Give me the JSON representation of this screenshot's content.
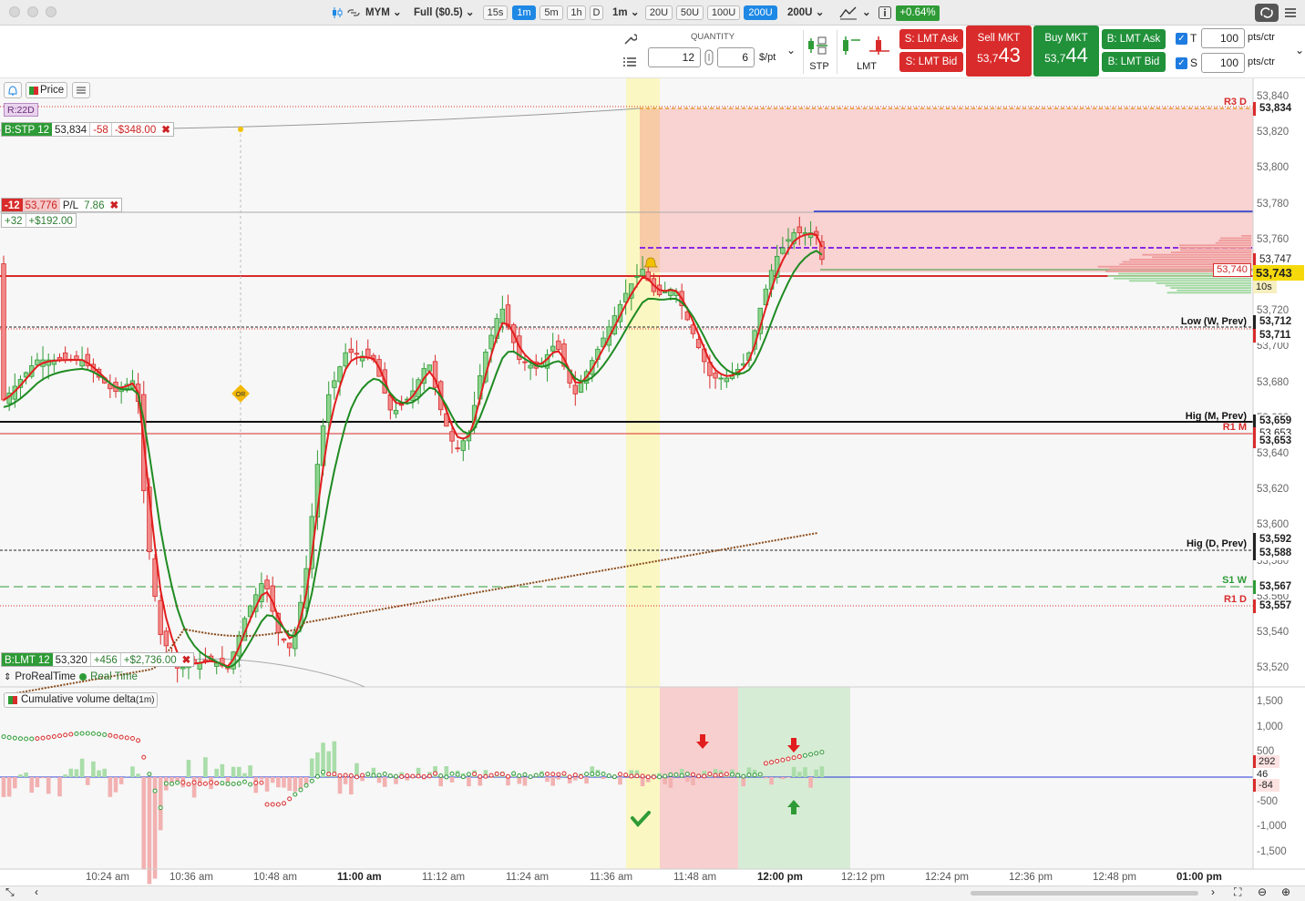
{
  "toolbar": {
    "symbol": "MYM",
    "contract": "Full ($0.5)",
    "intervals": [
      "15s",
      "1m",
      "5m",
      "1h",
      "D"
    ],
    "active_interval": "1m",
    "bar_interval": "1m",
    "ranges": [
      "20U",
      "50U",
      "100U",
      "200U"
    ],
    "active_range": "200U",
    "range_select": "200U",
    "change_pct": "+0.64%"
  },
  "order_panel": {
    "quantity_label": "QUANTITY",
    "quantity": "12",
    "per_point": "6",
    "per_point_unit": "$/pt",
    "stp_label": "STP",
    "lmt_label": "LMT",
    "s_lmt_ask": "S: LMT Ask",
    "s_lmt_bid": "S: LMT Bid",
    "sell_mkt_label": "Sell MKT",
    "sell_price_prefix": "53,7",
    "sell_price_big": "43",
    "buy_mkt_label": "Buy MKT",
    "buy_price_prefix": "53,7",
    "buy_price_big": "44",
    "b_lmt_ask": "B: LMT Ask",
    "b_lmt_bid": "B: LMT Bid",
    "t_label": "T",
    "t_value": "100",
    "s_label": "S",
    "s_value": "100",
    "pts_ctr": "pts/ctr"
  },
  "chart_header": {
    "price_label": "Price",
    "r22d": "R:22D",
    "stp_order": {
      "label": "B:STP 12",
      "price": "53,834",
      "pts": "-58",
      "usd": "-$348.00"
    },
    "position": {
      "qty": "-12",
      "price": "53,776",
      "pl_label": "P/L",
      "pl": "7.86",
      "pts": "+32",
      "usd": "+$192.00"
    },
    "lmt_order": {
      "label": "B:LMT 12",
      "price": "53,320",
      "pts": "+456",
      "usd": "+$2,736.00"
    },
    "feed": "ProRealTime",
    "feed_status": "Real Time",
    "or_badge": "OR",
    "timer": "10s"
  },
  "levels": {
    "r3d": "R3 D",
    "low_w": "Low (W, Prev)",
    "hig_m": "Hig (M, Prev)",
    "r1m": "R1 M",
    "hig_d": "Hig (D, Prev)",
    "s1w": "S1 W",
    "r1d": "R1 D"
  },
  "price_tags": {
    "r3d": "53,834",
    "ask_a": "53,747",
    "last": "53,743",
    "entry": "53,740",
    "low_w": "53,712",
    "low_w2": "53,711",
    "hig_m": "53,659",
    "r1m_a": "53,653",
    "r1m_b": "53,653",
    "hig_d": "53,592",
    "hig_d2": "53,588",
    "s1w": "53,567",
    "r1d": "53,557"
  },
  "y_axis": [
    "53,840",
    "53,820",
    "53,800",
    "53,780",
    "53,760",
    "53,740",
    "53,720",
    "53,700",
    "53,680",
    "53,660",
    "53,640",
    "53,620",
    "53,600",
    "53,580",
    "53,560",
    "53,540",
    "53,520"
  ],
  "indicator": {
    "title": "Cumulative volume delta",
    "interval": "(1m)",
    "axis": [
      "1,500",
      "1,000",
      "500",
      "0",
      "-500",
      "-1,000",
      "-1,500"
    ],
    "tag_up": "292",
    "tag_mid": "46",
    "tag_down": "-84"
  },
  "x_axis": [
    "10:24 am",
    "10:36 am",
    "10:48 am",
    "11:00 am",
    "11:12 am",
    "11:24 am",
    "11:36 am",
    "11:48 am",
    "12:00 pm",
    "12:12 pm",
    "12:24 pm",
    "12:36 pm",
    "12:48 pm",
    "01:00 pm"
  ],
  "colors": {
    "bull": "#2e9b36",
    "bear": "#d92b2b",
    "accent": "#1e88e5"
  },
  "chart_data": {
    "type": "candlestick",
    "interval": "1m",
    "ylim": [
      53510,
      53845
    ],
    "last_price": 53743
  }
}
